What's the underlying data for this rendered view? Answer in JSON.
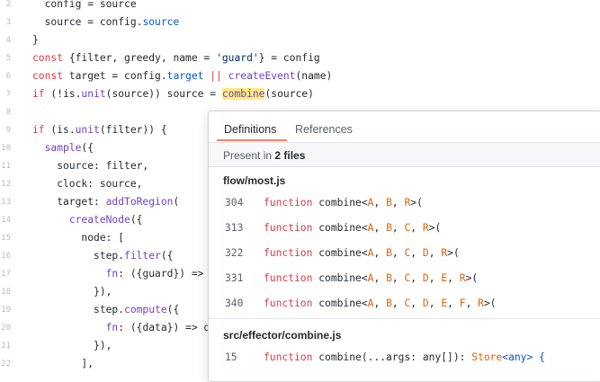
{
  "code_lines": [
    {
      "ln": "2",
      "tokens": [
        {
          "t": "  config = source",
          "c": ""
        }
      ]
    },
    {
      "ln": "3",
      "tokens": [
        {
          "t": "  source = config.",
          "c": ""
        },
        {
          "t": "source",
          "c": "p"
        }
      ]
    },
    {
      "ln": "4",
      "tokens": [
        {
          "t": "}",
          "c": ""
        }
      ]
    },
    {
      "ln": "5",
      "tokens": [
        {
          "t": "const",
          "c": "k"
        },
        {
          "t": " {filter, greedy, name = ",
          "c": ""
        },
        {
          "t": "'guard'",
          "c": "s"
        },
        {
          "t": "} = config",
          "c": ""
        }
      ]
    },
    {
      "ln": "6",
      "tokens": [
        {
          "t": "const",
          "c": "k"
        },
        {
          "t": " target = config.",
          "c": ""
        },
        {
          "t": "target",
          "c": "p"
        },
        {
          "t": " || ",
          "c": "k"
        },
        {
          "t": "createEvent",
          "c": "f"
        },
        {
          "t": "(name)",
          "c": ""
        }
      ]
    },
    {
      "ln": "7",
      "tokens": [
        {
          "t": "if",
          "c": "k"
        },
        {
          "t": " (!is.",
          "c": ""
        },
        {
          "t": "unit",
          "c": "f"
        },
        {
          "t": "(source)) source = ",
          "c": ""
        },
        {
          "t": "combine",
          "c": "f hl"
        },
        {
          "t": "(source)",
          "c": ""
        }
      ]
    },
    {
      "ln": "8",
      "tokens": []
    },
    {
      "ln": "9",
      "tokens": [
        {
          "t": "if",
          "c": "k"
        },
        {
          "t": " (is.",
          "c": ""
        },
        {
          "t": "unit",
          "c": "f"
        },
        {
          "t": "(filter)) {",
          "c": ""
        }
      ]
    },
    {
      "ln": "10",
      "tokens": [
        {
          "t": "  ",
          "c": ""
        },
        {
          "t": "sample",
          "c": "f"
        },
        {
          "t": "({",
          "c": ""
        }
      ]
    },
    {
      "ln": "11",
      "tokens": [
        {
          "t": "    source: filter,",
          "c": ""
        }
      ]
    },
    {
      "ln": "12",
      "tokens": [
        {
          "t": "    clock: source,",
          "c": ""
        }
      ]
    },
    {
      "ln": "13",
      "tokens": [
        {
          "t": "    target: ",
          "c": ""
        },
        {
          "t": "addToRegion",
          "c": "f"
        },
        {
          "t": "(",
          "c": ""
        }
      ]
    },
    {
      "ln": "14",
      "tokens": [
        {
          "t": "      ",
          "c": ""
        },
        {
          "t": "createNode",
          "c": "f"
        },
        {
          "t": "({",
          "c": ""
        }
      ]
    },
    {
      "ln": "15",
      "tokens": [
        {
          "t": "        node: [",
          "c": ""
        }
      ]
    },
    {
      "ln": "16",
      "tokens": [
        {
          "t": "          step.",
          "c": ""
        },
        {
          "t": "filter",
          "c": "f"
        },
        {
          "t": "({",
          "c": ""
        }
      ]
    },
    {
      "ln": "17",
      "tokens": [
        {
          "t": "            ",
          "c": ""
        },
        {
          "t": "fn",
          "c": "f"
        },
        {
          "t": ": ({guard}) => g",
          "c": ""
        }
      ]
    },
    {
      "ln": "18",
      "tokens": [
        {
          "t": "          }),",
          "c": ""
        }
      ]
    },
    {
      "ln": "19",
      "tokens": [
        {
          "t": "          step.",
          "c": ""
        },
        {
          "t": "compute",
          "c": "f"
        },
        {
          "t": "({",
          "c": ""
        }
      ]
    },
    {
      "ln": "20",
      "tokens": [
        {
          "t": "            ",
          "c": ""
        },
        {
          "t": "fn",
          "c": "f"
        },
        {
          "t": ": ({data}) => da",
          "c": ""
        }
      ]
    },
    {
      "ln": "21",
      "tokens": [
        {
          "t": "          }),",
          "c": ""
        }
      ]
    },
    {
      "ln": "22",
      "tokens": [
        {
          "t": "        ],",
          "c": ""
        }
      ]
    }
  ],
  "popup": {
    "tabs": {
      "definitions": "Definitions",
      "references": "References"
    },
    "summary_prefix": "Present in ",
    "summary_count": "2 files",
    "files": [
      {
        "name": "flow/most.js",
        "results": [
          {
            "ln": "304",
            "tokens": [
              {
                "t": "function",
                "c": "k"
              },
              {
                "t": " combine<",
                "c": ""
              },
              {
                "t": "A",
                "c": "o"
              },
              {
                "t": ", ",
                "c": ""
              },
              {
                "t": "B",
                "c": "o"
              },
              {
                "t": ", ",
                "c": ""
              },
              {
                "t": "R",
                "c": "o"
              },
              {
                "t": ">(",
                "c": ""
              }
            ]
          },
          {
            "ln": "313",
            "tokens": [
              {
                "t": "function",
                "c": "k"
              },
              {
                "t": " combine<",
                "c": ""
              },
              {
                "t": "A",
                "c": "o"
              },
              {
                "t": ", ",
                "c": ""
              },
              {
                "t": "B",
                "c": "o"
              },
              {
                "t": ", ",
                "c": ""
              },
              {
                "t": "C",
                "c": "o"
              },
              {
                "t": ", ",
                "c": ""
              },
              {
                "t": "R",
                "c": "o"
              },
              {
                "t": ">(",
                "c": ""
              }
            ]
          },
          {
            "ln": "322",
            "tokens": [
              {
                "t": "function",
                "c": "k"
              },
              {
                "t": " combine<",
                "c": ""
              },
              {
                "t": "A",
                "c": "o"
              },
              {
                "t": ", ",
                "c": ""
              },
              {
                "t": "B",
                "c": "o"
              },
              {
                "t": ", ",
                "c": ""
              },
              {
                "t": "C",
                "c": "o"
              },
              {
                "t": ", ",
                "c": ""
              },
              {
                "t": "D",
                "c": "o"
              },
              {
                "t": ", ",
                "c": ""
              },
              {
                "t": "R",
                "c": "o"
              },
              {
                "t": ">(",
                "c": ""
              }
            ]
          },
          {
            "ln": "331",
            "tokens": [
              {
                "t": "function",
                "c": "k"
              },
              {
                "t": " combine<",
                "c": ""
              },
              {
                "t": "A",
                "c": "o"
              },
              {
                "t": ", ",
                "c": ""
              },
              {
                "t": "B",
                "c": "o"
              },
              {
                "t": ", ",
                "c": ""
              },
              {
                "t": "C",
                "c": "o"
              },
              {
                "t": ", ",
                "c": ""
              },
              {
                "t": "D",
                "c": "o"
              },
              {
                "t": ", ",
                "c": ""
              },
              {
                "t": "E",
                "c": "o"
              },
              {
                "t": ", ",
                "c": ""
              },
              {
                "t": "R",
                "c": "o"
              },
              {
                "t": ">(",
                "c": ""
              }
            ]
          },
          {
            "ln": "340",
            "tokens": [
              {
                "t": "function",
                "c": "k"
              },
              {
                "t": " combine<",
                "c": ""
              },
              {
                "t": "A",
                "c": "o"
              },
              {
                "t": ", ",
                "c": ""
              },
              {
                "t": "B",
                "c": "o"
              },
              {
                "t": ", ",
                "c": ""
              },
              {
                "t": "C",
                "c": "o"
              },
              {
                "t": ", ",
                "c": ""
              },
              {
                "t": "D",
                "c": "o"
              },
              {
                "t": ", ",
                "c": ""
              },
              {
                "t": "E",
                "c": "o"
              },
              {
                "t": ", ",
                "c": ""
              },
              {
                "t": "F",
                "c": "o"
              },
              {
                "t": ", ",
                "c": ""
              },
              {
                "t": "R",
                "c": "o"
              },
              {
                "t": ">(",
                "c": ""
              }
            ]
          }
        ]
      },
      {
        "name": "src/effector/combine.js",
        "results": [
          {
            "ln": "15",
            "tokens": [
              {
                "t": "function",
                "c": "k"
              },
              {
                "t": " combine(...args: any[]): ",
                "c": ""
              },
              {
                "t": "Store",
                "c": "o"
              },
              {
                "t": "<any> {",
                "c": "p"
              }
            ]
          }
        ]
      }
    ]
  },
  "colors": {
    "keyword": "#d73a49",
    "function": "#6f42c1",
    "property": "#005cc5",
    "string": "#032f62",
    "type_param": "#e36209",
    "highlight": "#ffea7f",
    "tab_accent": "#f9826c"
  }
}
